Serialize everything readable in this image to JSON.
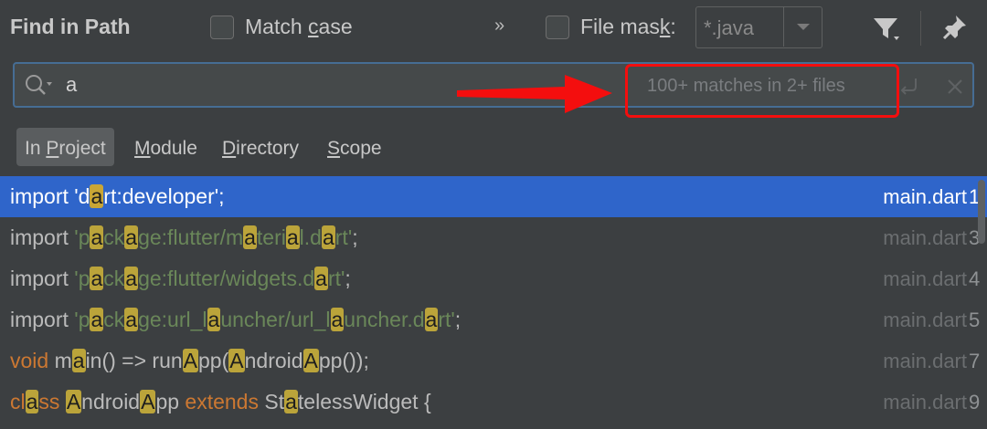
{
  "header": {
    "title": "Find in Path",
    "match_case": {
      "label_pre": "Match ",
      "label_mnemonic": "c",
      "label_post": "ase",
      "checked": false
    },
    "more_label": "»",
    "file_mask": {
      "label_pre": "File mas",
      "label_mnemonic": "k",
      "label_post": ":",
      "checked": false,
      "value": "*.java"
    }
  },
  "search": {
    "query": "a",
    "match_info": "100+ matches in 2+ files"
  },
  "tabs": [
    {
      "pre": "In ",
      "mnemonic": "P",
      "post": "roject",
      "active": true
    },
    {
      "pre": "",
      "mnemonic": "M",
      "post": "odule",
      "active": false
    },
    {
      "pre": "",
      "mnemonic": "D",
      "post": "irectory",
      "active": false
    },
    {
      "pre": "",
      "mnemonic": "S",
      "post": "cope",
      "active": false
    }
  ],
  "results": [
    {
      "selected": true,
      "segments": [
        {
          "t": "import 'd",
          "c": "plain"
        },
        {
          "t": "a",
          "c": "hl"
        },
        {
          "t": "rt:developer';",
          "c": "plain"
        }
      ],
      "file": "main.dart",
      "line": "1"
    },
    {
      "selected": false,
      "segments": [
        {
          "t": "import ",
          "c": "plain"
        },
        {
          "t": "'p",
          "c": "str"
        },
        {
          "t": "a",
          "c": "hl"
        },
        {
          "t": "ck",
          "c": "str"
        },
        {
          "t": "a",
          "c": "hl"
        },
        {
          "t": "ge:flutter/m",
          "c": "str"
        },
        {
          "t": "a",
          "c": "hl"
        },
        {
          "t": "teri",
          "c": "str"
        },
        {
          "t": "a",
          "c": "hl"
        },
        {
          "t": "l.d",
          "c": "str"
        },
        {
          "t": "a",
          "c": "hl"
        },
        {
          "t": "rt'",
          "c": "str"
        },
        {
          "t": ";",
          "c": "plain"
        }
      ],
      "file": "main.dart",
      "line": "3"
    },
    {
      "selected": false,
      "segments": [
        {
          "t": "import ",
          "c": "plain"
        },
        {
          "t": "'p",
          "c": "str"
        },
        {
          "t": "a",
          "c": "hl"
        },
        {
          "t": "ck",
          "c": "str"
        },
        {
          "t": "a",
          "c": "hl"
        },
        {
          "t": "ge:flutter/widgets.d",
          "c": "str"
        },
        {
          "t": "a",
          "c": "hl"
        },
        {
          "t": "rt'",
          "c": "str"
        },
        {
          "t": ";",
          "c": "plain"
        }
      ],
      "file": "main.dart",
      "line": "4"
    },
    {
      "selected": false,
      "segments": [
        {
          "t": "import ",
          "c": "plain"
        },
        {
          "t": "'p",
          "c": "str"
        },
        {
          "t": "a",
          "c": "hl"
        },
        {
          "t": "ck",
          "c": "str"
        },
        {
          "t": "a",
          "c": "hl"
        },
        {
          "t": "ge:url_l",
          "c": "str"
        },
        {
          "t": "a",
          "c": "hl"
        },
        {
          "t": "uncher/url_l",
          "c": "str"
        },
        {
          "t": "a",
          "c": "hl"
        },
        {
          "t": "uncher.d",
          "c": "str"
        },
        {
          "t": "a",
          "c": "hl"
        },
        {
          "t": "rt'",
          "c": "str"
        },
        {
          "t": ";",
          "c": "plain"
        }
      ],
      "file": "main.dart",
      "line": "5"
    },
    {
      "selected": false,
      "segments": [
        {
          "t": "void",
          "c": "kw"
        },
        {
          "t": " m",
          "c": "plain"
        },
        {
          "t": "a",
          "c": "hl"
        },
        {
          "t": "in() => run",
          "c": "plain"
        },
        {
          "t": "A",
          "c": "hl"
        },
        {
          "t": "pp(",
          "c": "plain"
        },
        {
          "t": "A",
          "c": "hl"
        },
        {
          "t": "ndroid",
          "c": "plain"
        },
        {
          "t": "A",
          "c": "hl"
        },
        {
          "t": "pp());",
          "c": "plain"
        }
      ],
      "file": "main.dart",
      "line": "7"
    },
    {
      "selected": false,
      "segments": [
        {
          "t": "cl",
          "c": "kw"
        },
        {
          "t": "a",
          "c": "hl"
        },
        {
          "t": "ss",
          "c": "kw"
        },
        {
          "t": " ",
          "c": "plain"
        },
        {
          "t": "A",
          "c": "hl"
        },
        {
          "t": "ndroid",
          "c": "plain"
        },
        {
          "t": "A",
          "c": "hl"
        },
        {
          "t": "pp ",
          "c": "plain"
        },
        {
          "t": "extends",
          "c": "kw"
        },
        {
          "t": " St",
          "c": "plain"
        },
        {
          "t": "a",
          "c": "hl"
        },
        {
          "t": "telessWidget {",
          "c": "plain"
        }
      ],
      "file": "main.dart",
      "line": "9"
    }
  ],
  "colors": {
    "background": "#3c3f41",
    "selection": "#2f65ca",
    "highlight": "#bba43a",
    "keyword": "#cc7832",
    "string": "#6a8759",
    "annotation": "#f40e0e"
  },
  "icons": [
    "search-icon",
    "filter-icon",
    "pin-icon",
    "enter-icon",
    "clear-icon",
    "annotation-arrow"
  ]
}
